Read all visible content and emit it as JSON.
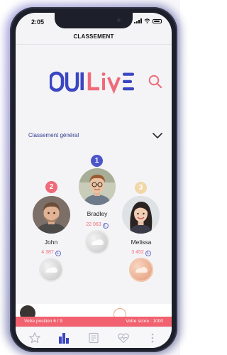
{
  "status_bar": {
    "time": "2:05"
  },
  "nav": {
    "title": "CLASSEMENT"
  },
  "brand": {
    "name": "OUI LIVE"
  },
  "ranking": {
    "label": "Classement général"
  },
  "podium": [
    {
      "rank": "1",
      "name": "Bradley",
      "score": "22 063"
    },
    {
      "rank": "2",
      "name": "John",
      "score": "4 387"
    },
    {
      "rank": "3",
      "name": "Melissa",
      "score": "3 452"
    }
  ],
  "coin_symbol": "L",
  "footer": {
    "position": "Votre position 6 / 9",
    "score": "Votre score : 1000"
  },
  "tabs": [
    {
      "name": "favorites",
      "icon": "star-icon"
    },
    {
      "name": "ranking",
      "icon": "bar-chart-icon"
    },
    {
      "name": "news",
      "icon": "document-icon"
    },
    {
      "name": "health",
      "icon": "heart-pulse-icon"
    },
    {
      "name": "more",
      "icon": "more-vertical-icon"
    }
  ],
  "colors": {
    "brand_blue": "#3b46c2",
    "brand_pink": "#f06b7a",
    "accent": "#4b55c9"
  }
}
